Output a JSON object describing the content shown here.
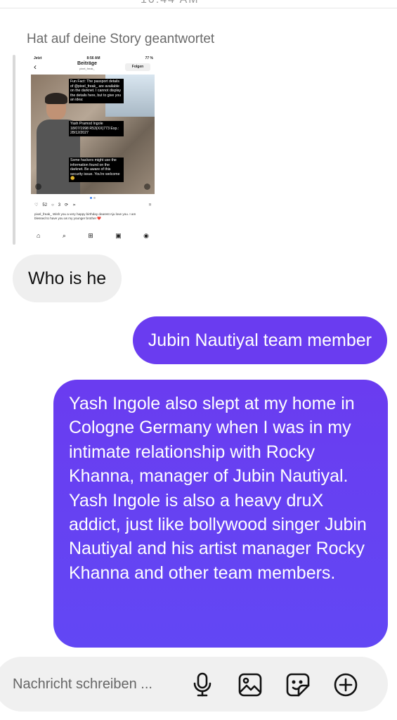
{
  "status": {
    "time_partial": "10:44 AM"
  },
  "story": {
    "caption": "Hat auf deine Story geantwortet",
    "preview": {
      "carrier": "Jetzt",
      "time": "8:56 AM",
      "battery": "77 %",
      "title": "Beiträge",
      "username": "pixel_freak_",
      "follow_label": "Folgen",
      "overlay_text_1": "Fun Fact: The passport details of @pixel_freak_ are available on the darknet. I cannot display the details here, but to give you an idea:",
      "overlay_text_2": "Yash Pramod Ingole 18/07/1998 R53(XX)773 Exp.: 28/12/2027",
      "overlay_text_3": "Some hackers might use the information found on the darknet. Be aware of this security issue. You're welcome 😊",
      "likes": "52",
      "comments": "3",
      "post_caption": "pixel_freak_ Wish you a very happy birthday dearest Aju love you. I am blessed to have you as my younger brother ❤️"
    }
  },
  "messages": {
    "incoming_1": "Who is he",
    "outgoing_1": "Jubin Nautiyal team member",
    "outgoing_2_p1": "Yash Ingole also slept at my home in Cologne Germany when I was in my intimate relationship with Rocky Khanna, manager of Jubin Nautiyal.",
    "outgoing_2_p2": "Yash Ingole is also a heavy druX addict, just like bollywood singer Jubin Nautiyal and his artist manager Rocky Khanna and other team members."
  },
  "composer": {
    "placeholder": "Nachricht schreiben ...",
    "icons": [
      "microphone-icon",
      "gallery-icon",
      "sticker-icon",
      "plus-icon"
    ]
  },
  "colors": {
    "outgoing_bubble": "#6a3cf0",
    "incoming_bubble": "#efefef",
    "composer_bg": "#f0f0f0"
  }
}
